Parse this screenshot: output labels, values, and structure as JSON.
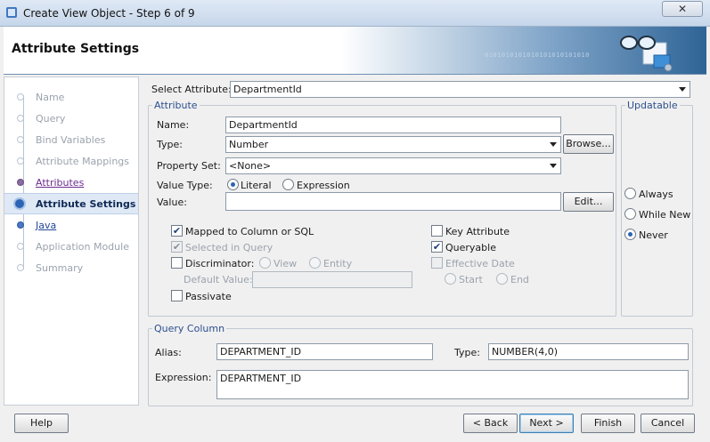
{
  "window": {
    "title": "Create View Object - Step 6 of 9",
    "close_label": "✕"
  },
  "header": {
    "title": "Attribute Settings",
    "binary": "0101010101010101010101010"
  },
  "nav": {
    "steps": [
      {
        "label": "Name",
        "state": "done"
      },
      {
        "label": "Query",
        "state": "done"
      },
      {
        "label": "Bind Variables",
        "state": "done"
      },
      {
        "label": "Attribute Mappings",
        "state": "done"
      },
      {
        "label": "Attributes",
        "state": "visited"
      },
      {
        "label": "Attribute Settings",
        "state": "current"
      },
      {
        "label": "Java",
        "state": "link"
      },
      {
        "label": "Application Module",
        "state": "future"
      },
      {
        "label": "Summary",
        "state": "future"
      }
    ]
  },
  "select_attribute": {
    "label": "Select Attribute:",
    "value": "DepartmentId"
  },
  "attribute": {
    "group_title": "Attribute",
    "name_label": "Name:",
    "name_value": "DepartmentId",
    "type_label": "Type:",
    "type_value": "Number",
    "browse_label": "Browse...",
    "property_set_label": "Property Set:",
    "property_set_value": "<None>",
    "value_type_label": "Value Type:",
    "literal_label": "Literal",
    "expression_label": "Expression",
    "value_label": "Value:",
    "value_value": "",
    "edit_label": "Edit...",
    "mapped_label": "Mapped to Column or SQL",
    "selected_in_query_label": "Selected in Query",
    "discriminator_label": "Discriminator:",
    "view_label": "View",
    "entity_label": "Entity",
    "default_value_label": "Default Value:",
    "default_value_value": "",
    "passivate_label": "Passivate",
    "key_attribute_label": "Key Attribute",
    "queryable_label": "Queryable",
    "effective_date_label": "Effective Date",
    "start_label": "Start",
    "end_label": "End"
  },
  "updatable": {
    "group_title": "Updatable",
    "always_label": "Always",
    "while_new_label": "While New",
    "never_label": "Never"
  },
  "query_column": {
    "group_title": "Query Column",
    "alias_label": "Alias:",
    "alias_value": "DEPARTMENT_ID",
    "type_label": "Type:",
    "type_value": "NUMBER(4,0)",
    "expression_label": "Expression:",
    "expression_value": "DEPARTMENT_ID"
  },
  "footer": {
    "help_label": "Help",
    "back_label": "< Back",
    "next_label": "Next >",
    "finish_label": "Finish",
    "cancel_label": "Cancel"
  },
  "checks": {
    "mapped": "✔",
    "selected_in_query": "✔",
    "queryable": "✔"
  }
}
